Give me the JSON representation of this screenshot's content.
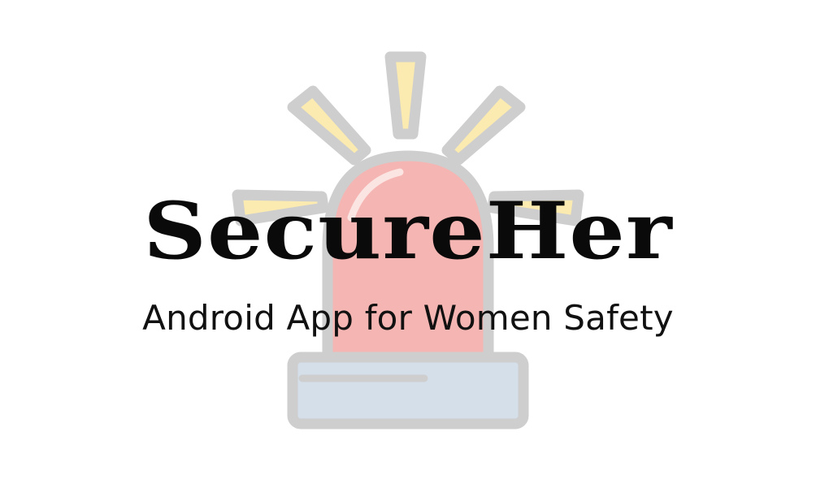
{
  "logo": {
    "icon": "siren-icon",
    "colors": {
      "outline": "#c4c4c4",
      "rays": "#fbe79f",
      "dome": "#f4a6a2",
      "dome_highlight": "#f8d2cf",
      "base": "#cbd8e6"
    }
  },
  "title": "SecureHer",
  "subtitle": "Android App for Women Safety"
}
